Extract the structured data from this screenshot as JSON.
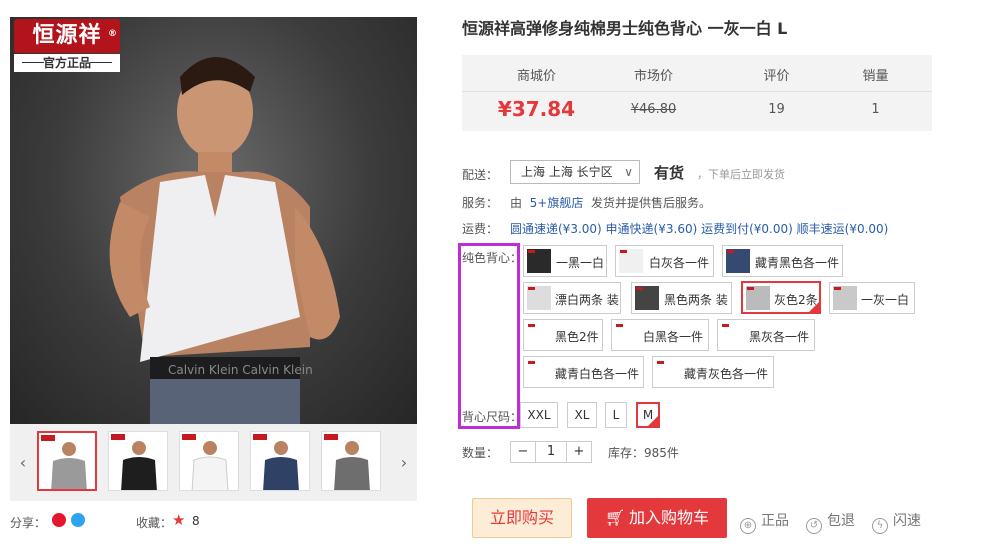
{
  "brand": {
    "logo_text": "恒源祥",
    "logo_sub": "官方正品",
    "logo_mark": "®",
    "brand_color": "#b3131b"
  },
  "product": {
    "title": "恒源祥高弹修身纯棉男士纯色背心 一灰一白 L"
  },
  "price_table": {
    "headers": [
      "商城价",
      "市场价",
      "评价",
      "销量"
    ],
    "values": {
      "mall_price": "¥37.84",
      "market_price": "¥46.80",
      "reviews": "19",
      "sales": "1"
    },
    "accent": "#e4393c"
  },
  "delivery": {
    "label": "配送：",
    "location": "上海 上海 长宁区",
    "stock_status": "有货",
    "stock_note": "，下单后立即发货"
  },
  "service": {
    "label": "服务：",
    "prefix": "由",
    "store": "5+旗舰店",
    "suffix": "发货并提供售后服务。"
  },
  "shipping": {
    "label": "运费：",
    "options": [
      "圆通速递(¥3.00)",
      "申通快递(¥3.60)",
      "运费到付(¥0.00)",
      "顺丰速运(¥0.00)"
    ]
  },
  "color_group": {
    "label": "纯色背心：",
    "options": [
      "一黑一白",
      "白灰各一件",
      "藏青黑色各一件",
      "漂白两条 装",
      "黑色两条 装",
      "灰色2条",
      "一灰一白",
      "黑色2件",
      "白黑各一件",
      "黑灰各一件",
      "藏青白色各一件",
      "藏青灰色各一件"
    ],
    "selected": "灰色2条"
  },
  "size_group": {
    "label": "背心尺码：",
    "options": [
      "XXL",
      "XL",
      "L",
      "M"
    ],
    "selected": "M"
  },
  "quantity": {
    "label": "数量：",
    "value": "1",
    "minus": "−",
    "plus": "+",
    "stock_text": "库存：985件"
  },
  "actions": {
    "buy_now": "立即购买",
    "add_to_cart": "加入购物车"
  },
  "guarantees": [
    "正品",
    "包退",
    "闪速"
  ],
  "share": {
    "label": "分享：",
    "favorite_label": "收藏：",
    "favorite_count": "8"
  },
  "gallery": {
    "prev": "‹",
    "next": "›",
    "thumbnails": [
      "gray-tshirt",
      "black-tshirt",
      "white-tshirt",
      "navy-tshirt",
      "gray-vneck"
    ]
  }
}
